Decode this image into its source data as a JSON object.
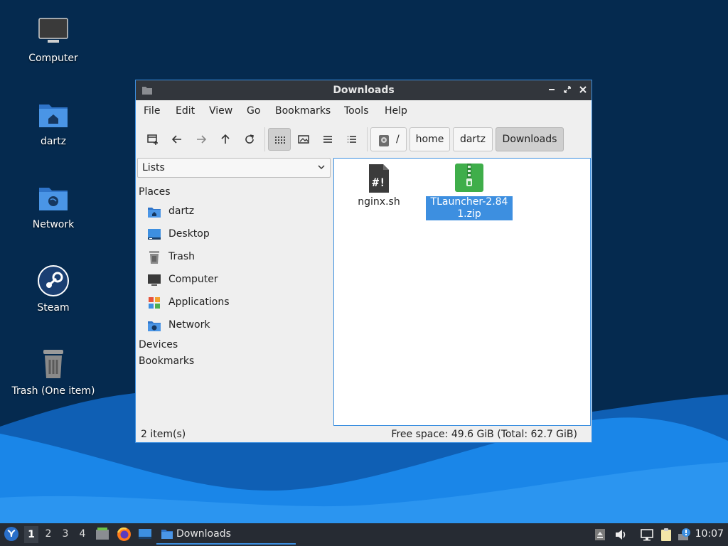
{
  "desktop": {
    "icons": [
      {
        "label": "Computer",
        "icon": "monitor-icon"
      },
      {
        "label": "dartz",
        "icon": "home-folder-icon"
      },
      {
        "label": "Network",
        "icon": "network-folder-icon"
      },
      {
        "label": "Steam",
        "icon": "steam-icon"
      },
      {
        "label": "Trash (One item)",
        "icon": "trash-icon"
      }
    ]
  },
  "window": {
    "title": "Downloads",
    "menu": [
      "File",
      "Edit",
      "View",
      "Go",
      "Bookmarks",
      "Tools",
      "Help"
    ],
    "breadcrumb": {
      "root": "/",
      "items": [
        "home",
        "dartz",
        "Downloads"
      ]
    },
    "sidebar": {
      "view_select": "Lists",
      "places_heading": "Places",
      "places": [
        {
          "label": "dartz",
          "icon": "home-folder-icon"
        },
        {
          "label": "Desktop",
          "icon": "desktop-icon"
        },
        {
          "label": "Trash",
          "icon": "trash-icon"
        },
        {
          "label": "Computer",
          "icon": "monitor-icon"
        },
        {
          "label": "Applications",
          "icon": "applications-icon"
        },
        {
          "label": "Network",
          "icon": "network-folder-icon"
        }
      ],
      "devices_heading": "Devices",
      "bookmarks_heading": "Bookmarks"
    },
    "files": [
      {
        "name": "nginx.sh",
        "icon": "shell-script-icon",
        "selected": false
      },
      {
        "name": "TLauncher-2.841.zip",
        "icon": "zip-archive-icon",
        "selected": true
      }
    ],
    "status": {
      "count": "2 item(s)",
      "free_space": "Free space: 49.6 GiB (Total: 62.7 GiB)"
    }
  },
  "taskbar": {
    "workspaces": [
      "1",
      "2",
      "3",
      "4"
    ],
    "active_workspace": "1",
    "task_label": "Downloads",
    "clock": "10:07"
  },
  "colors": {
    "accent": "#3c8fe0",
    "titlebar": "#32363c",
    "taskbar": "#262b33",
    "wallpaper_dark": "#052a4f",
    "wallpaper_wave": "#1a86e8"
  }
}
